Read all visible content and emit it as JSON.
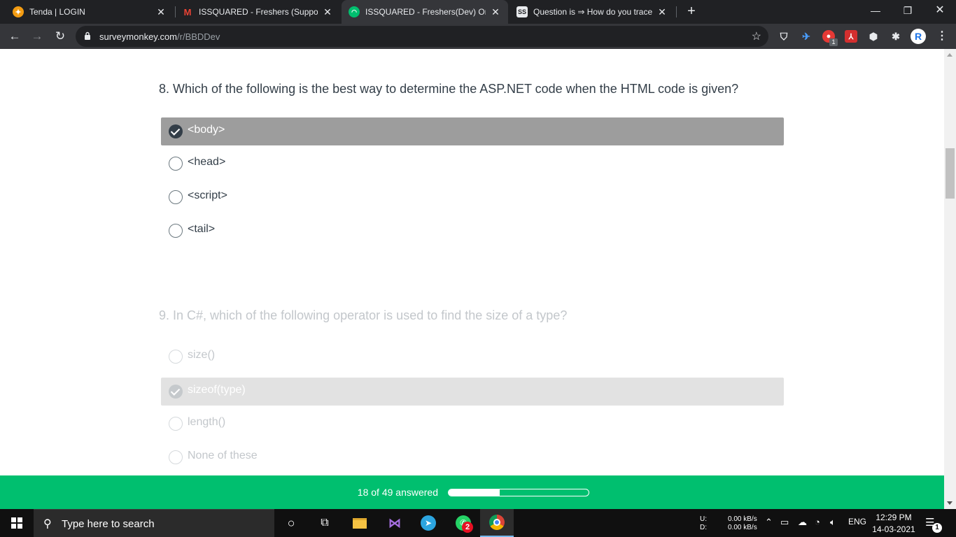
{
  "browser": {
    "tabs": [
      {
        "title": "Tenda | LOGIN",
        "favicon": "tenda-icon",
        "active": false
      },
      {
        "title": "ISSQUARED - Freshers (Support)",
        "favicon": "gmail-icon",
        "active": false
      },
      {
        "title": "ISSQUARED - Freshers(Dev) Onlin",
        "favicon": "surveymonkey-icon",
        "active": true
      },
      {
        "title": "Question is ⇒ How do you trace",
        "favicon": "stackshare-icon",
        "active": false
      }
    ],
    "url_host": "surveymonkey.com",
    "url_path": "/r/BBDDev",
    "extension_badge": "1",
    "profile_letter": "R",
    "accent_color": "#00bf6f"
  },
  "survey": {
    "questions": [
      {
        "number_title": "8. Which of the following is the best way to determine the ASP.NET code when the HTML code is given?",
        "active": true,
        "answers": [
          {
            "label": "<body>",
            "selected": true
          },
          {
            "label": "<head>",
            "selected": false
          },
          {
            "label": "<script>",
            "selected": false
          },
          {
            "label": "<tail>",
            "selected": false
          }
        ]
      },
      {
        "number_title": "9. In C#, which of the following operator is used to find the size of a type?",
        "active": false,
        "answers": [
          {
            "label": "size()",
            "selected": false
          },
          {
            "label": "sizeof(type)",
            "selected": true
          },
          {
            "label": "length()",
            "selected": false
          },
          {
            "label": "None of these",
            "selected": false
          }
        ]
      }
    ],
    "progress": {
      "text": "18 of 49 answered",
      "answered": 18,
      "total": 49
    }
  },
  "taskbar": {
    "search_placeholder": "Type here to search",
    "whatsapp_badge": "2",
    "net_up_label": "U:",
    "net_down_label": "D:",
    "net_up": "0.00 kB/s",
    "net_down": "0.00 kB/s",
    "language": "ENG",
    "time": "12:29 PM",
    "date": "14-03-2021",
    "notification_count": "1"
  }
}
